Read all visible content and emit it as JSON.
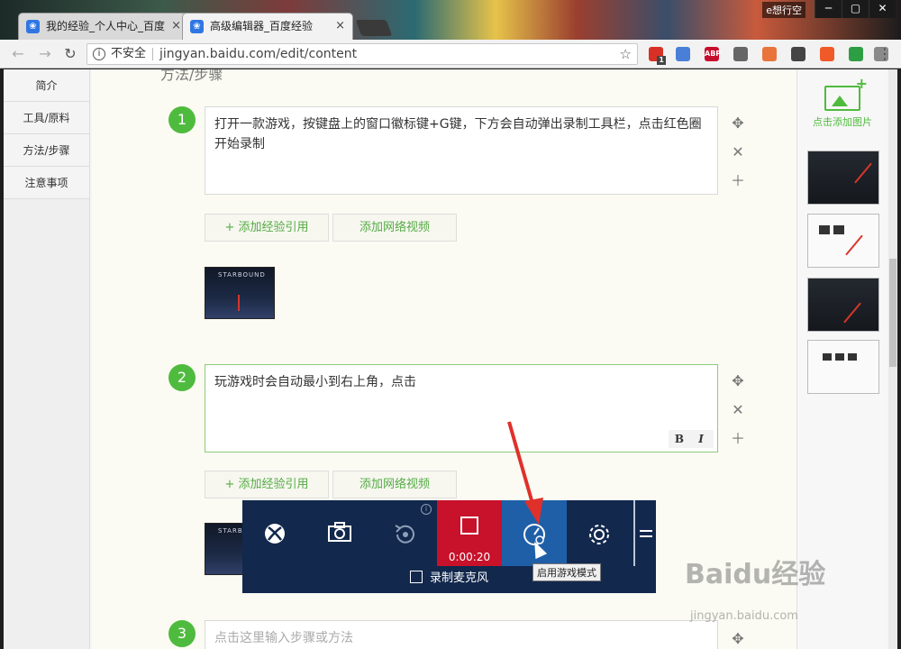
{
  "browser": {
    "tabs": [
      {
        "title": "我的经验_个人中心_百度"
      },
      {
        "title": "高级编辑器_百度经验"
      }
    ],
    "profile_name": "e想行空",
    "address": {
      "security_label": "不安全",
      "url": "jingyan.baidu.com/edit/content"
    },
    "extensions": [
      {
        "name": "red-ext-icon",
        "badge": "1",
        "color": "#d93025"
      },
      {
        "name": "translate-icon",
        "color": "#4a7fd8"
      },
      {
        "name": "abp-icon",
        "label": "ABP",
        "color": "#c70d2c"
      },
      {
        "name": "ext-grey-icon",
        "color": "#666666"
      },
      {
        "name": "ext-orange-icon",
        "color": "#e8743b"
      },
      {
        "name": "ext-dark-icon",
        "color": "#444444"
      },
      {
        "name": "ext-lifebuoy-icon",
        "color": "#f05a28"
      },
      {
        "name": "ext-green-icon",
        "color": "#2e9e44"
      },
      {
        "name": "ext-cloud-icon",
        "color": "#8a8a8a"
      }
    ]
  },
  "left_nav": {
    "items": [
      "简介",
      "工具/原料",
      "方法/步骤",
      "注意事项"
    ]
  },
  "editor": {
    "section_title": "方法/步骤",
    "steps": [
      {
        "number": "1",
        "text": "打开一款游戏，按键盘上的窗口徽标键+G键，下方会自动弹出录制工具栏，点击红色圈开始录制"
      },
      {
        "number": "2",
        "text": "玩游戏时会自动最小到右上角，点击"
      },
      {
        "number": "3",
        "placeholder": "点击这里输入步骤或方法"
      }
    ],
    "add_quote_label": "+ 添加经验引用",
    "add_video_label": "添加网络视频",
    "thumb_text": "STARBOUND",
    "bold_label": "B",
    "italic_label": "I"
  },
  "right_panel": {
    "add_image_label": "点击添加图片"
  },
  "game_bar": {
    "timer": "0:00:20",
    "mic_label": "录制麦克风",
    "tooltip": "启用游戏模式",
    "colors": {
      "bg": "#12284d",
      "record": "#c8112a",
      "game_mode": "#1f5fa8"
    }
  },
  "watermark": {
    "logo": "Baidu经验",
    "url": "jingyan.baidu.com"
  }
}
